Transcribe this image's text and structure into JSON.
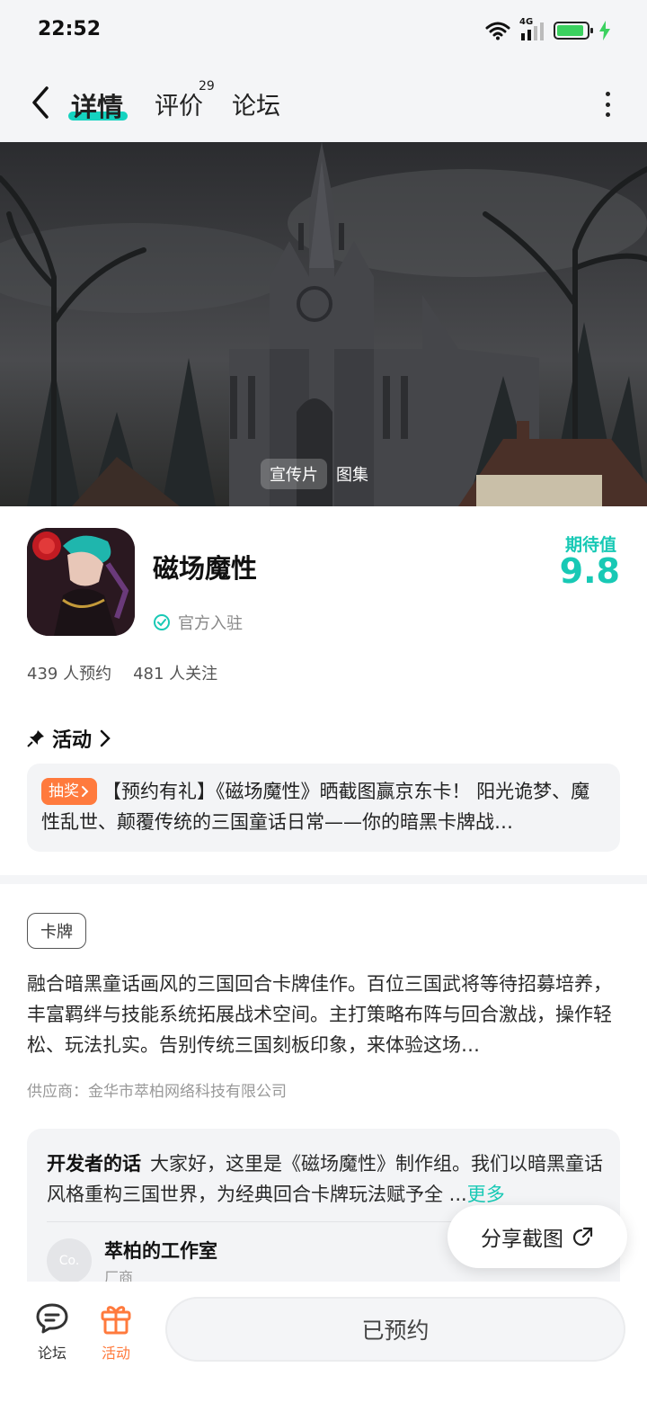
{
  "status_bar": {
    "time": "22:52",
    "network_label": "4G",
    "battery_level": 0.9,
    "battery_color": "#3bd15f"
  },
  "nav": {
    "tabs": [
      {
        "label": "详情",
        "active": true
      },
      {
        "label": "评价",
        "badge": "29"
      },
      {
        "label": "论坛"
      }
    ],
    "accent_color": "#15d3c0"
  },
  "hero": {
    "media_tabs": [
      {
        "label": "宣传片",
        "active": true
      },
      {
        "label": "图集"
      }
    ]
  },
  "app": {
    "name": "磁场魔性",
    "official_label": "官方入驻",
    "expect_label": "期待值",
    "expect_value": "9.8",
    "reservations": "439 人预约",
    "followers": "481 人关注"
  },
  "activity": {
    "heading": "活动",
    "badge": "抽奖",
    "text": "【预约有礼】《磁场魔性》晒截图赢京东卡！ 阳光诡梦、魔性乱世、颠覆传统的三国童话日常——你的暗黑卡牌战…"
  },
  "description": {
    "genre_tag": "卡牌",
    "text": "融合暗黑童话画风的三国回合卡牌佳作。百位三国武将等待招募培养，丰富羁绊与技能系统拓展战术空间。主打策略布阵与回合激战，操作轻松、玩法扎实。告别传统三国刻板印象，来体验这场…",
    "supplier": "供应商：金华市萃柏网络科技有限公司"
  },
  "developer": {
    "label": "开发者的话",
    "text": "大家好，这里是《磁场魔性》制作组。我们以暗黑童话风格重构三国世界，为经典回合卡牌玩法赋予全 ...",
    "more_label": "更多",
    "studio_avatar_text": "Co.",
    "studio_name": "萃柏的工作室",
    "studio_role": "厂商"
  },
  "share": {
    "label": "分享截图"
  },
  "bottom_bar": {
    "forum_label": "论坛",
    "activity_label": "活动",
    "reserve_label": "已预约",
    "activity_color": "#ff7a3d"
  }
}
